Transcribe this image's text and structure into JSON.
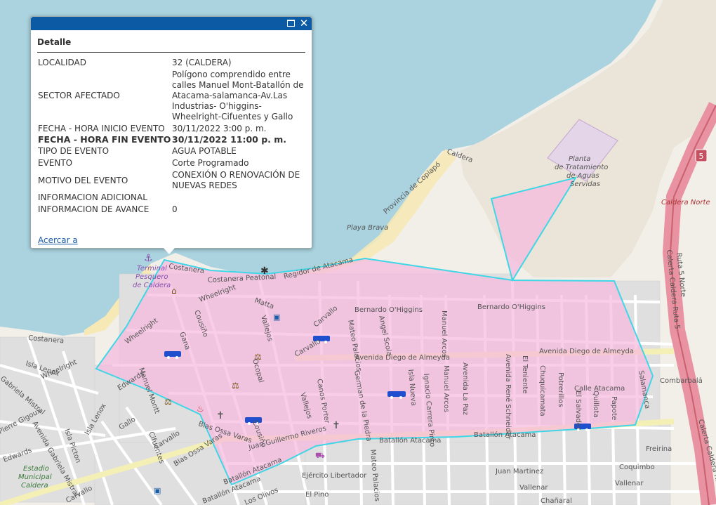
{
  "popup": {
    "title": "Detalle",
    "rows": [
      {
        "key": "LOCALIDAD",
        "value": "32 (CALDERA)"
      },
      {
        "key": "SECTOR AFECTADO",
        "value": "Polígono comprendido entre calles Manuel Mont-Batallón de Atacama-salamanca-Av.Las Industrias- O'higgins-Wheelright-Cifuentes y Gallo"
      },
      {
        "key": "FECHA - HORA INICIO EVENTO",
        "value": "30/11/2022 3:00 p. m."
      },
      {
        "key": "FECHA - HORA FIN EVENTO",
        "value": "30/11/2022 11:00 p. m."
      },
      {
        "key": "TIPO DE EVENTO",
        "value": "AGUA POTABLE"
      },
      {
        "key": "EVENTO",
        "value": "Corte Programado"
      },
      {
        "key": "MOTIVO DEL EVENTO",
        "value": "CONEXIÓN O RENOVACIÓN DE NUEVAS REDES"
      },
      {
        "key": "INFORMACION ADICIONAL",
        "value": ""
      },
      {
        "key": "INFORMACION DE AVANCE",
        "value": "0"
      }
    ],
    "zoom_link": "Acercar a",
    "maximize_icon": "maximize-icon",
    "close_icon": "close-icon"
  },
  "map": {
    "colors": {
      "sea": "#aad3df",
      "land": "#f2efe9",
      "beach": "#f7e9b5",
      "affected_fill": "#f6b8de",
      "affected_outline": "#3fd6e6",
      "residential": "#e0dfdf",
      "highway": "#e892a2",
      "road": "#ffffff",
      "water_truck": "#1f4fcf"
    },
    "labels": {
      "costanera_peatonal": "Costanera Peatonal",
      "costanera": "Costanera",
      "regidor": "Regidor de Atacama",
      "terminal1": "Terminal",
      "terminal2": "Pesquero",
      "terminal3": "de Caldera",
      "wheelright": "Wheelright",
      "wheelright2": "Wheelright",
      "matta": "Matta",
      "ohiggins1": "Bernardo O'Higgins",
      "ohiggins2": "Bernardo O'Higgins",
      "almeyda1": "Avenida Diego de Almeyda",
      "almeyda2": "Avenida Diego de Almeyda",
      "batallon1": "Batallón Atacama",
      "batallon2": "Batallón Atacama",
      "batallon3": "Batallón Atacama",
      "batallon4": "Batallón Atacama",
      "calle_atacama": "Calle Atacama",
      "carvallo1": "Carvallo",
      "carvallo2": "Carvallo",
      "carvallo3": "Carvallo",
      "gallo": "Gallo",
      "edwards": "Edwards",
      "edwards2": "Edwards",
      "isla_lenox": "Isla Lenox",
      "isla_lenox2": "Isla Lenox",
      "gabriela1": "Gabriela Mistral",
      "gabriela2": "Avenida Gabriela Mistral",
      "pierre": "Pierre Gigoux",
      "isla_picton": "Isla Picton",
      "cifuentes": "Cifuentes",
      "blas_ossa": "Blas Ossa Varas",
      "blas_ossa2": "Blas Ossa Varas",
      "juan_guillermo": "Juan Guillermo Riveros",
      "canos_porter": "Canos Porter",
      "german": "German de la Piedra",
      "ignacio": "Ignacio Carrera Pinto",
      "isla_nueva": "Isla Nueva",
      "manuel_arcos": "Manuel Arcos",
      "manuel_arcos2": "Manuel Arcos",
      "la_paz": "Avenida La Paz",
      "schneider": "Avenida René Schneider",
      "el_teniente": "El Teniente",
      "chuquicamata": "Chuquicamata",
      "potrerillos": "Potrerillos",
      "el_salvador": "El Salvador",
      "quillota": "Quillota",
      "papote": "Papote",
      "salamanca": "Salamanca",
      "combarbala": "Combarbalá",
      "freirina": "Freirina",
      "coquimbo": "Coquimbo",
      "vallenar": "Vallenar",
      "juan_martinez": "Juan Martinez",
      "chanaral": "Chañaral",
      "ejercito": "Ejército Libertador",
      "el_pino": "El Pino",
      "los_olivos": "Los Olivos",
      "mateo_palacios": "Mateo Palacios",
      "angel_scola": "Angel Scola",
      "vallejos": "Vallejos",
      "vallejos2": "Vallejos",
      "ocopal": "Ocopal",
      "cousino": "Cousiño",
      "cousino2": "Cousiño",
      "gana": "Gana",
      "montt": "Manuel Montt",
      "carvallo_v": "Carvallo",
      "prov_copiapo": "Provincia de Copiapó",
      "caldera_road": "Caldera",
      "playa_brava": "Playa Brava",
      "planta1": "Planta",
      "planta2": "de Tratamiento",
      "planta3": "de Aguas",
      "planta4": "Servidas",
      "estadio1": "Estadio",
      "estadio2": "Municipal",
      "estadio3": "Caldera",
      "ruta5norte": "Ruta 5 Norte",
      "ruta5": "Calerta Caldera Ruta 5",
      "ruta5b": "Calerta Caldera Ruta 5",
      "caldera_norte": "Caldera Norte",
      "shield": "5"
    }
  }
}
